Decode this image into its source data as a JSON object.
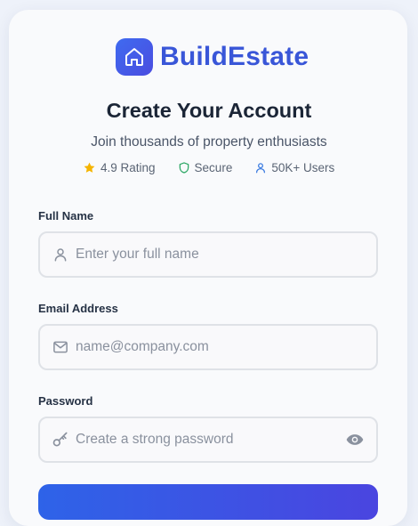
{
  "brand": {
    "name": "BuildEstate",
    "logo_icon": "home-icon",
    "color": "#3956d8"
  },
  "header": {
    "title": "Create Your Account",
    "subtitle": "Join thousands of property enthusiasts"
  },
  "badges": [
    {
      "icon": "star-icon",
      "label": "4.9 Rating",
      "color": "#f5b400"
    },
    {
      "icon": "shield-icon",
      "label": "Secure",
      "color": "#2fa866"
    },
    {
      "icon": "user-icon",
      "label": "50K+ Users",
      "color": "#3b7be0"
    }
  ],
  "form": {
    "full_name": {
      "label": "Full Name",
      "placeholder": "Enter your full name",
      "value": "",
      "icon": "user-icon"
    },
    "email": {
      "label": "Email Address",
      "placeholder": "name@company.com",
      "value": "",
      "icon": "mail-icon"
    },
    "password": {
      "label": "Password",
      "placeholder": "Create a strong password",
      "value": "",
      "icon": "key-icon",
      "toggle_icon": "eye-icon"
    },
    "submit_label": ""
  },
  "colors": {
    "accent_start": "#2e63e8",
    "accent_end": "#4a45e0",
    "heading": "#1b2536",
    "input_border": "#dfe2e7"
  }
}
